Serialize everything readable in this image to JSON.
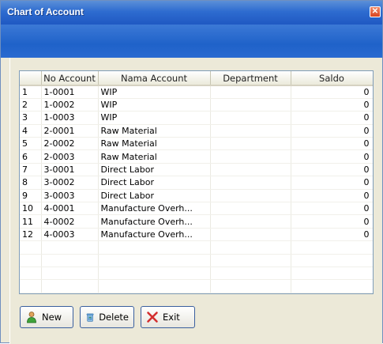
{
  "window": {
    "title": "Chart of Account",
    "close_symbol": "✕"
  },
  "colors": {
    "titlebar": "#2e6cd0",
    "banner": "#1f62c9",
    "exit_x": "#d32f2f"
  },
  "table": {
    "columns": [
      "",
      "No Account",
      "Nama Account",
      "Department",
      "Saldo"
    ],
    "rows": [
      [
        "1",
        "1-0001",
        "WIP",
        "",
        "0"
      ],
      [
        "2",
        "1-0002",
        "WIP",
        "",
        "0"
      ],
      [
        "3",
        "1-0003",
        "WIP",
        "",
        "0"
      ],
      [
        "4",
        "2-0001",
        "Raw Material",
        "",
        "0"
      ],
      [
        "5",
        "2-0002",
        "Raw Material",
        "",
        "0"
      ],
      [
        "6",
        "2-0003",
        "Raw Material",
        "",
        "0"
      ],
      [
        "7",
        "3-0001",
        "Direct Labor",
        "",
        "0"
      ],
      [
        "8",
        "3-0002",
        "Direct Labor",
        "",
        "0"
      ],
      [
        "9",
        "3-0003",
        "Direct Labor",
        "",
        "0"
      ],
      [
        "10",
        "4-0001",
        "Manufacture Overh...",
        "",
        "0"
      ],
      [
        "11",
        "4-0002",
        "Manufacture Overh...",
        "",
        "0"
      ],
      [
        "12",
        "4-0003",
        "Manufacture Overh...",
        "",
        "0"
      ]
    ]
  },
  "buttons": {
    "new": {
      "label": "New",
      "icon": "user-add-icon"
    },
    "delete": {
      "label": "Delete",
      "icon": "recycle-bin-icon"
    },
    "exit": {
      "label": "Exit",
      "icon": "red-x-icon"
    }
  }
}
